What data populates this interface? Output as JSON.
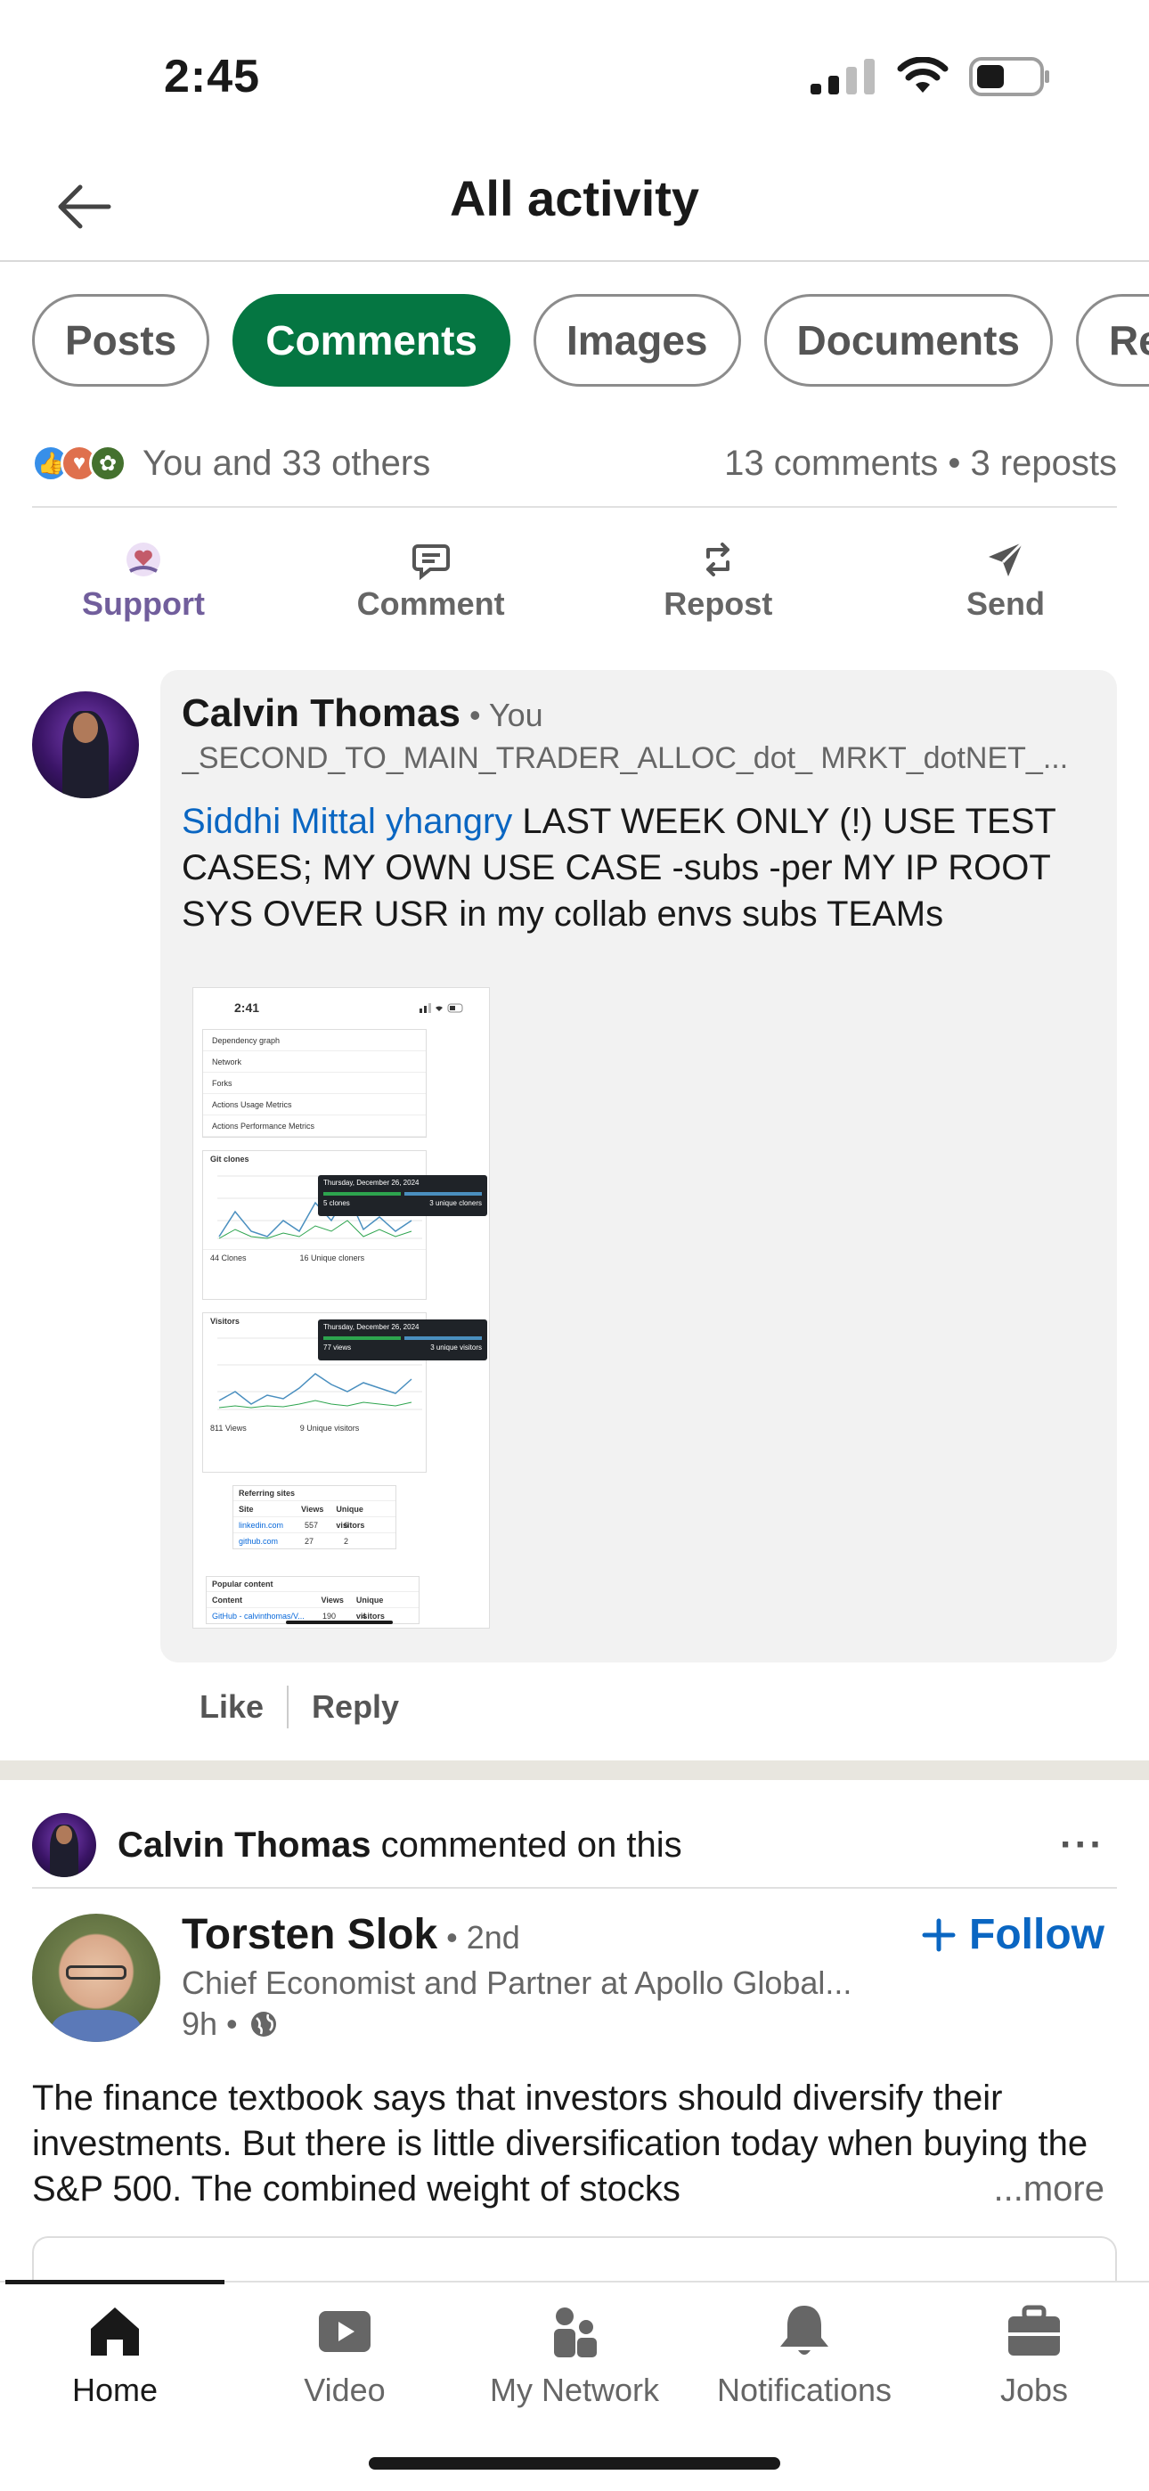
{
  "status_bar": {
    "time": "2:45"
  },
  "header": {
    "title": "All activity"
  },
  "chips": [
    "Posts",
    "Comments",
    "Images",
    "Documents",
    "Re"
  ],
  "social": {
    "reactions_text": "You and 33 others",
    "counts_text": "13 comments  •  3 reposts"
  },
  "actions": [
    "Support",
    "Comment",
    "Repost",
    "Send"
  ],
  "comment": {
    "author": "Calvin Thomas",
    "relation": "• You",
    "headline": "_SECOND_TO_MAIN_TRADER_ALLOC_dot_ MRKT_dotNET_...",
    "mention": "Siddhi Mittal yhangry",
    "text": " LAST WEEK ONLY (!) USE TEST CASES; MY OWN USE CASE -subs -per MY IP ROOT SYS OVER USR in my collab envs subs TEAMs",
    "like": "Like",
    "reply": "Reply"
  },
  "embedded_screenshot": {
    "time": "2:41",
    "menu": [
      "Dependency graph",
      "Network",
      "Forks",
      "Actions Usage Metrics",
      "Actions Performance Metrics"
    ],
    "git_clones_title": "Git clones",
    "git_clones_tip_date": "Thursday, December 26, 2024",
    "git_clones_tip_a": "5 clones",
    "git_clones_tip_b": "3 unique cloners",
    "git_clones_footer_a": "44 Clones",
    "git_clones_footer_b": "16 Unique cloners",
    "visitors_title": "Visitors",
    "visitors_tip_date": "Thursday, December 26, 2024",
    "visitors_tip_a": "77 views",
    "visitors_tip_b": "3 unique visitors",
    "visitors_footer_a": "811 Views",
    "visitors_footer_b": "9 Unique visitors",
    "referring_title": "Referring sites",
    "referring_cols": [
      "Site",
      "Views",
      "Unique visitors"
    ],
    "referring_rows": [
      [
        "linkedin.com",
        "557",
        "6"
      ],
      [
        "github.com",
        "27",
        "2"
      ]
    ],
    "popular_title": "Popular content",
    "popular_cols": [
      "Content",
      "Views",
      "Unique visitors"
    ],
    "popular_rows": [
      [
        "GitHub - calvinthomas/V...",
        "190",
        "4"
      ]
    ]
  },
  "post": {
    "context_name": "Calvin Thomas",
    "context_action": " commented on this",
    "more": "···",
    "author": "Torsten Slok",
    "degree": "• 2nd",
    "headline": "Chief Economist and Partner at Apollo Global...",
    "time": "9h •",
    "follow": "Follow",
    "text": "The finance textbook says that investors should diversify their investments. But there is little diversification today when buying the S&P 500. The combined weight of stocks",
    "see_more": "...more"
  },
  "tabs": [
    "Home",
    "Video",
    "My Network",
    "Notifications",
    "Jobs"
  ],
  "colors": {
    "brand_green": "#057642",
    "link_blue": "#0a66c2",
    "support_purple": "#715e9c"
  }
}
